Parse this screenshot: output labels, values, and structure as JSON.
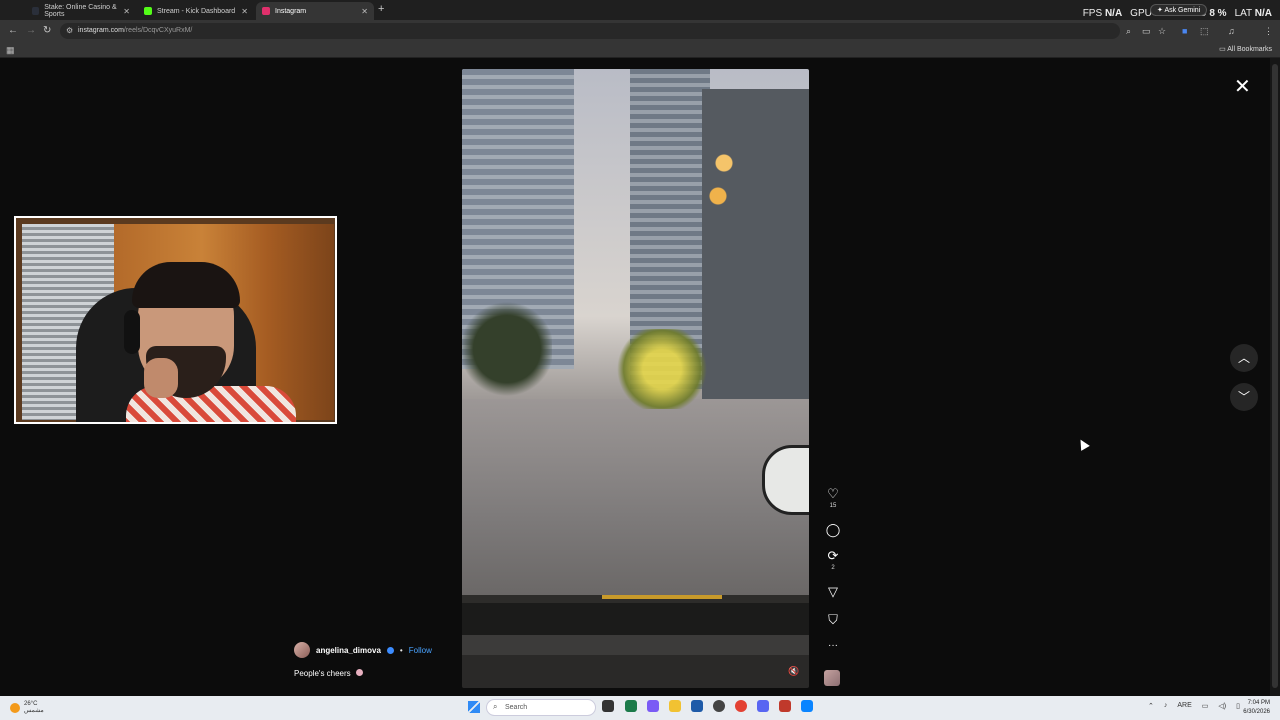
{
  "browser": {
    "tabs": [
      {
        "label": "Stake: Online Casino & Sports",
        "favicon_color": "#2a2f3a",
        "active": false
      },
      {
        "label": "Stream - Kick Dashboard",
        "favicon_color": "#53fc18",
        "active": false
      },
      {
        "label": "Instagram",
        "favicon_color": "#e1306c",
        "active": true
      }
    ],
    "close_glyph": "✕",
    "new_tab_glyph": "+",
    "gemini_label": "Ask Gemini",
    "url_host": "instagram.com",
    "url_path": "/reels/DcqvCXyuRxM/",
    "bookmarks_label": "All Bookmarks"
  },
  "overlay_stats": {
    "fps_label": "FPS",
    "fps_value": "N/A",
    "gpu_label": "GPU",
    "gpu_value": "18 %",
    "cpu_label": "CPU",
    "cpu_value": "8 %",
    "lat_label": "LAT",
    "lat_value": "N/A"
  },
  "reel": {
    "author": "angelina_dimova",
    "follow_label": "Follow",
    "separator": "•",
    "caption": "People's cheers",
    "like_count": "15",
    "repost_count": "2",
    "more_glyph": "···",
    "close_glyph": "✕",
    "up_glyph": "︿",
    "down_glyph": "﹀",
    "mute_glyph": "🔇",
    "icons": {
      "like": "heart-icon",
      "comment": "comment-icon",
      "repost": "repost-icon",
      "share": "send-icon",
      "save": "bookmark-icon"
    }
  },
  "taskbar": {
    "weather_temp": "26°C",
    "weather_desc": "مشمس",
    "search_placeholder": "Search",
    "tray_lang": "ARE",
    "time": "7:04 PM",
    "date": "6/30/2026"
  }
}
